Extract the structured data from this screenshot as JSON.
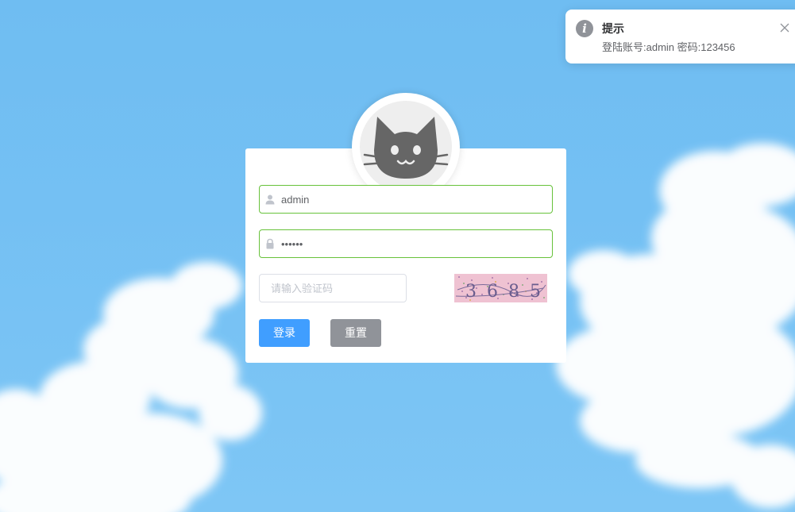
{
  "notification": {
    "title": "提示",
    "message": "登陆账号:admin 密码:123456"
  },
  "login": {
    "username_value": "admin",
    "password_value": "••••••",
    "captcha_placeholder": "请输入验证码",
    "captcha_text": "3685",
    "login_label": "登录",
    "reset_label": "重置"
  },
  "colors": {
    "primary": "#409eff",
    "info": "#909399",
    "success_border": "#67c23a",
    "sky": "#74c0f3"
  }
}
